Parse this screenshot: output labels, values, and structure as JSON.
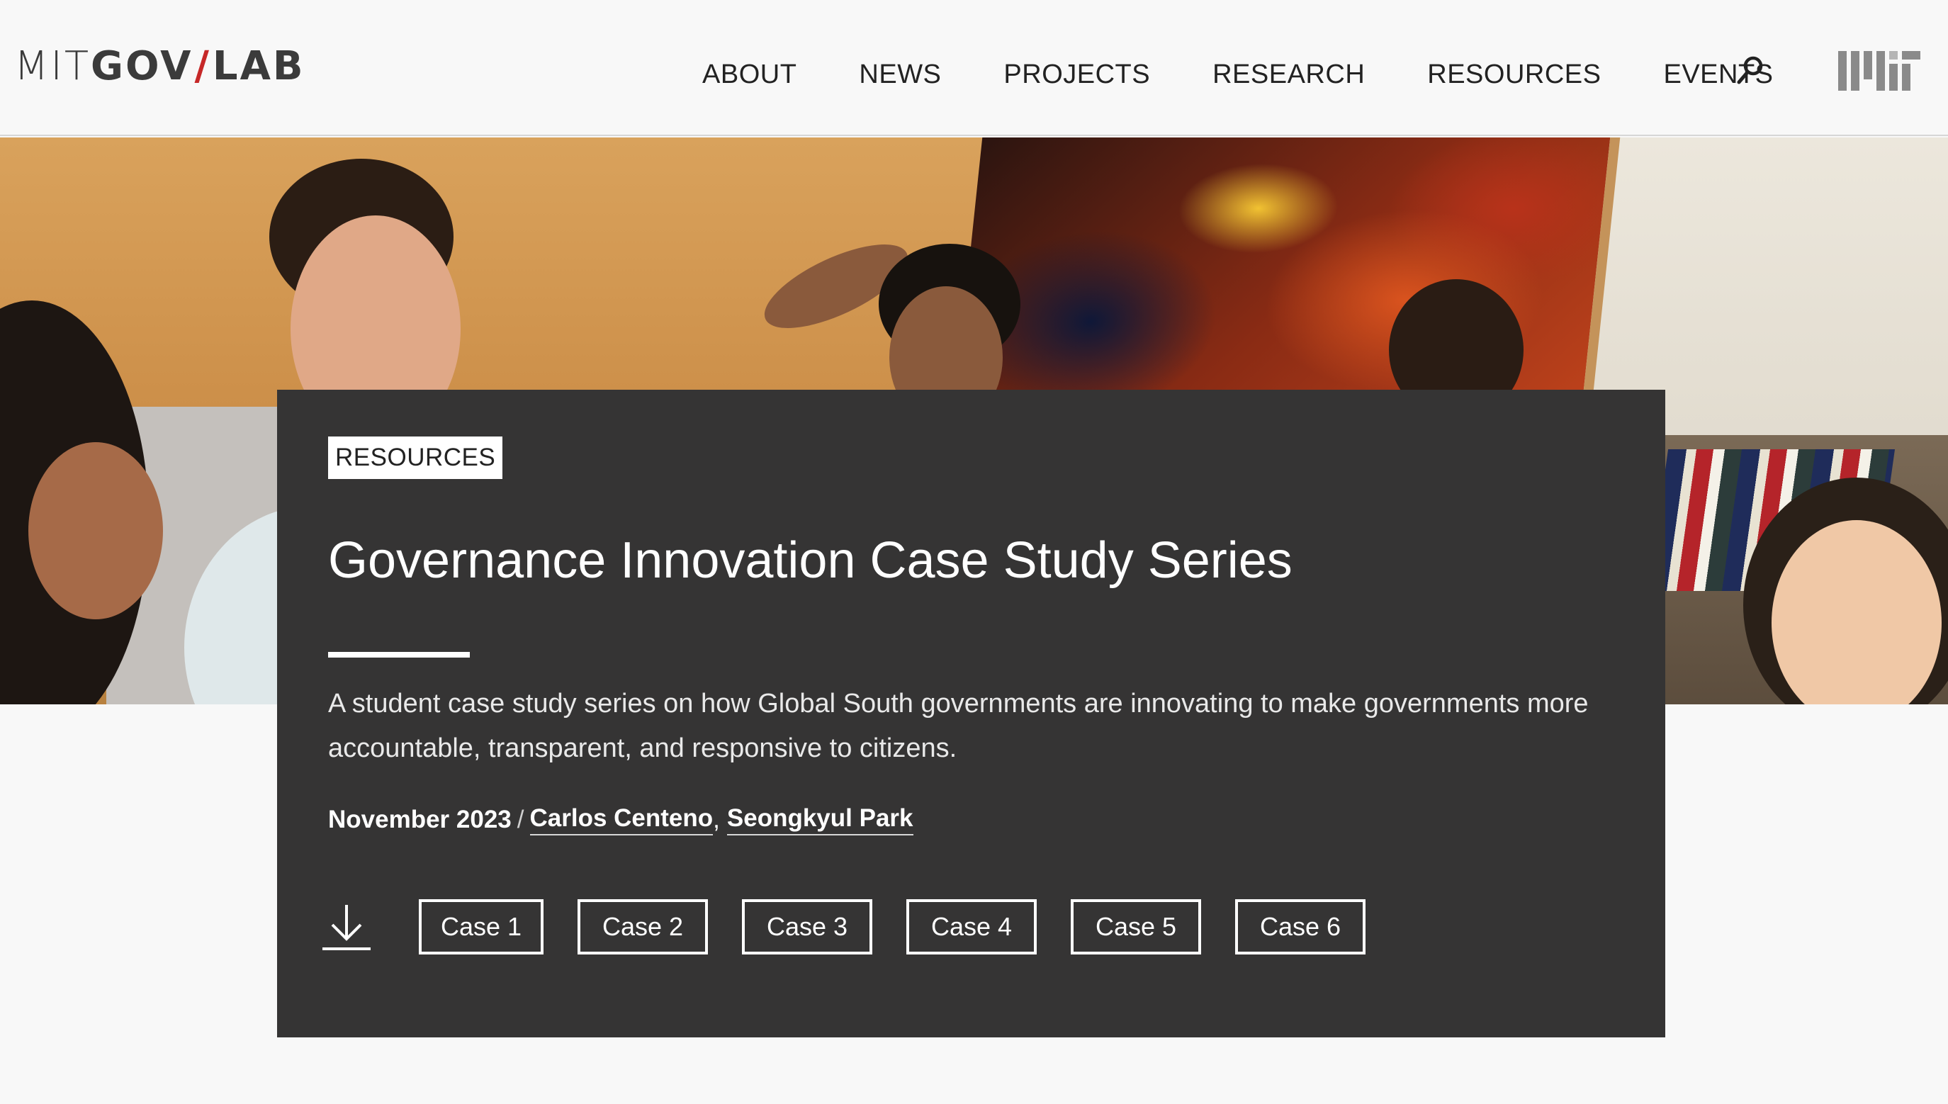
{
  "header": {
    "logo": {
      "part1": "MIT",
      "part2": "GOV",
      "slash": "/",
      "part3": "LAB"
    },
    "nav": [
      {
        "label": "ABOUT"
      },
      {
        "label": "NEWS"
      },
      {
        "label": "PROJECTS"
      },
      {
        "label": "RESEARCH"
      },
      {
        "label": "RESOURCES"
      },
      {
        "label": "EVENTS"
      }
    ],
    "search_icon": "search-icon",
    "mit_logo": "mit-logo"
  },
  "hero": {
    "image": "photo of students laughing in a room with a colorful painting and bookshelf"
  },
  "card": {
    "badge": "RESOURCES",
    "title": "Governance Innovation Case Study Series",
    "description": "A student case study series on how Global South governments are innovating to make governments more accountable, transparent, and responsive to citizens.",
    "date": "November 2023",
    "separator": "/",
    "authors": [
      {
        "name": "Carlos Centeno"
      },
      {
        "name": "Seongkyul Park"
      }
    ],
    "download_icon": "download-icon",
    "cases": [
      {
        "label": "Case 1"
      },
      {
        "label": "Case 2"
      },
      {
        "label": "Case 3"
      },
      {
        "label": "Case 4"
      },
      {
        "label": "Case 5"
      },
      {
        "label": "Case 6"
      }
    ]
  },
  "colors": {
    "card_bg": "#353434",
    "logo_slash": "#c62828",
    "page_bg": "#f8f8f8"
  }
}
